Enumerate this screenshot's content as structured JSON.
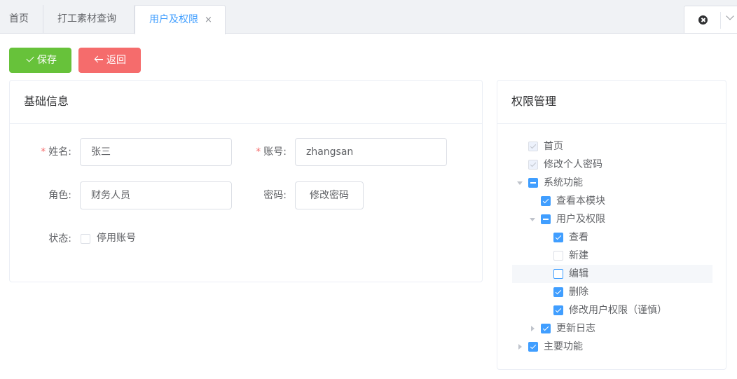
{
  "tabs": [
    {
      "label": "首页"
    },
    {
      "label": "打工素材查询"
    },
    {
      "label": "用户及权限",
      "close": "×"
    }
  ],
  "toolbar": {
    "save_label": "保存",
    "back_label": "返回"
  },
  "colors": {
    "primary": "#409eff",
    "success": "#67c23a",
    "danger": "#f56c6c"
  },
  "info": {
    "title": "基础信息",
    "name_label": "姓名:",
    "name_value": "张三",
    "account_label": "账号:",
    "account_value": "zhangsan",
    "role_label": "角色:",
    "role_value": "财务人员",
    "password_label": "密码:",
    "password_button": "修改密码",
    "status_label": "状态:",
    "status_option": "停用账号",
    "status_checked": false
  },
  "perm": {
    "title": "权限管理",
    "tree": [
      {
        "label": "首页",
        "state": "disabled"
      },
      {
        "label": "修改个人密码",
        "state": "disabled"
      },
      {
        "label": "系统功能",
        "state": "indeterminate",
        "expanded": true
      },
      {
        "label": "查看本模块",
        "state": "checked"
      },
      {
        "label": "用户及权限",
        "state": "indeterminate",
        "expanded": true
      },
      {
        "label": "查看",
        "state": "checked"
      },
      {
        "label": "新建",
        "state": "unchecked"
      },
      {
        "label": "编辑",
        "state": "unchecked"
      },
      {
        "label": "删除",
        "state": "checked"
      },
      {
        "label": "修改用户权限（谨慎）",
        "state": "checked"
      },
      {
        "label": "更新日志",
        "state": "checked",
        "expanded": false
      },
      {
        "label": "主要功能",
        "state": "checked",
        "expanded": false
      }
    ]
  }
}
